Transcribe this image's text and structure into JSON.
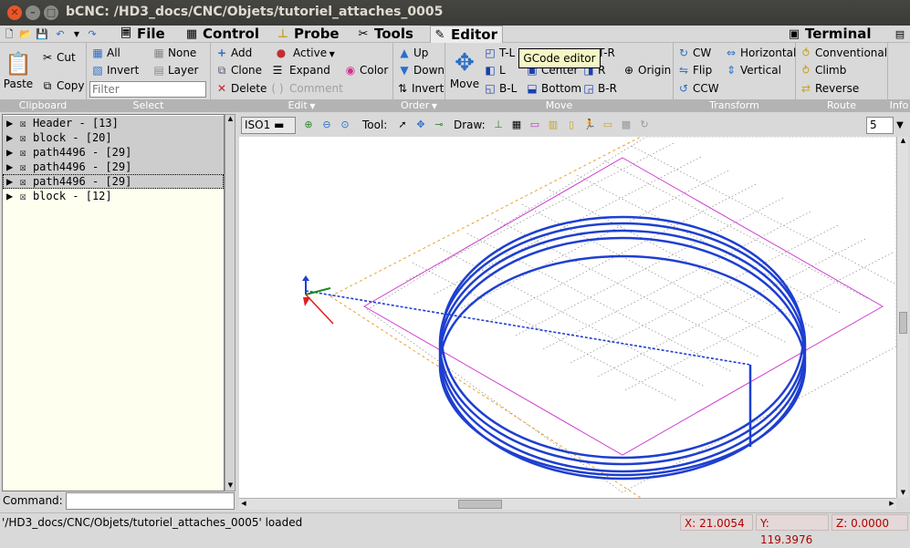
{
  "window": {
    "title": "bCNC: /HD3_docs/CNC/Objets/tutoriel_attaches_0005"
  },
  "menubar": {
    "tabs": [
      {
        "label": "File"
      },
      {
        "label": "Control"
      },
      {
        "label": "Probe"
      },
      {
        "label": "Tools"
      },
      {
        "label": "Editor"
      },
      {
        "label": "Terminal"
      }
    ]
  },
  "tooltip": "GCode editor",
  "ribbon": {
    "clipboard": {
      "label": "Clipboard",
      "paste": "Paste",
      "cut": "Cut",
      "copy": "Copy"
    },
    "select": {
      "label": "Select",
      "all": "All",
      "none": "None",
      "invert": "Invert",
      "layer": "Layer",
      "filter_placeholder": "Filter"
    },
    "edit": {
      "label": "Edit",
      "add": "Add",
      "active": "Active",
      "clone": "Clone",
      "expand": "Expand",
      "color": "Color",
      "delete": "Delete",
      "comment": "Comment"
    },
    "order": {
      "label": "Order",
      "up": "Up",
      "down": "Down",
      "invert": "Invert"
    },
    "move": {
      "label": "Move",
      "move": "Move",
      "tl": "T-L",
      "tr": "T-R",
      "l": "L",
      "center": "Center",
      "r": "R",
      "origin": "Origin",
      "bl": "B-L",
      "bottom": "Bottom",
      "br": "B-R"
    },
    "transform": {
      "label": "Transform",
      "cw": "CW",
      "horizontal": "Horizontal",
      "flip": "Flip",
      "vertical": "Vertical",
      "ccw": "CCW"
    },
    "route": {
      "label": "Route",
      "conventional": "Conventional",
      "climb": "Climb",
      "reverse": "Reverse"
    },
    "info": {
      "label": "Info"
    }
  },
  "tree": {
    "items": [
      {
        "label": "Header - [13]"
      },
      {
        "label": "block - [20]"
      },
      {
        "label": "path4496 - [29]"
      },
      {
        "label": "path4496 - [29]"
      },
      {
        "label": "path4496 - [29]"
      },
      {
        "label": "block - [12]"
      }
    ]
  },
  "command": {
    "label": "Command:"
  },
  "canvasbar": {
    "view": "ISO1",
    "tool_label": "Tool:",
    "draw_label": "Draw:",
    "spin_value": "5"
  },
  "status": {
    "message": "'/HD3_docs/CNC/Objets/tutoriel_attaches_0005' loaded",
    "x": "X: 21.0054",
    "y": "Y: 119.3976",
    "z": "Z: 0.0000"
  }
}
